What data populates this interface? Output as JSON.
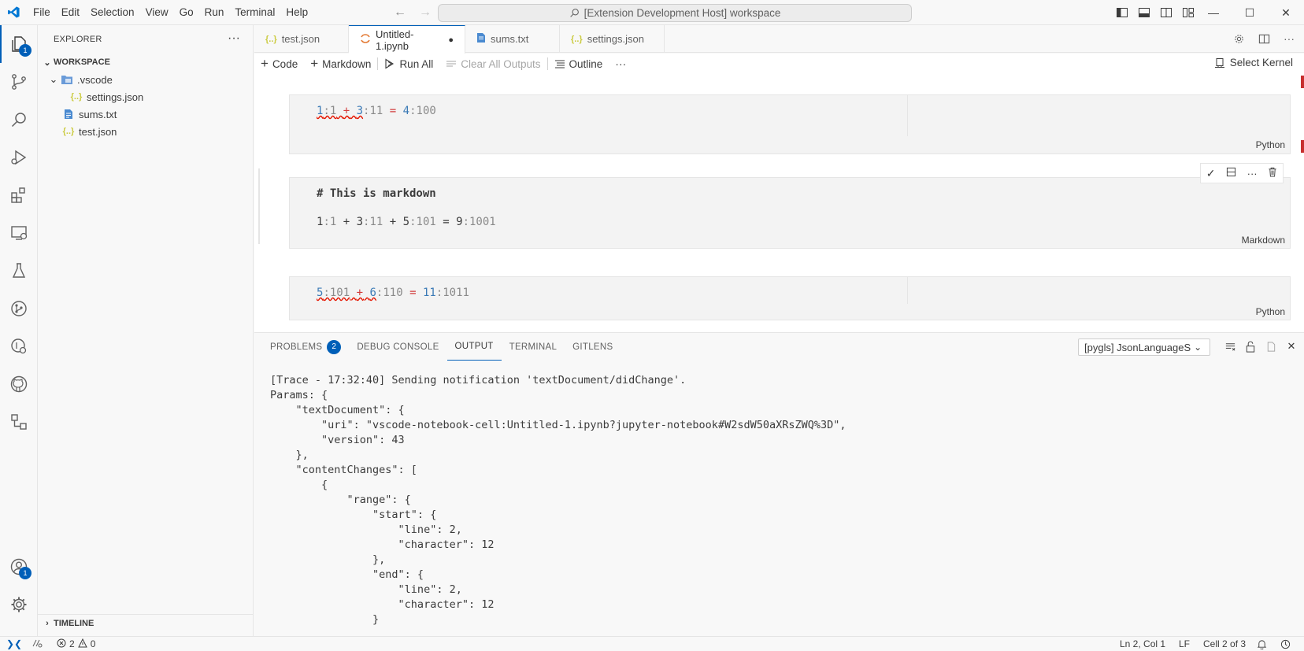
{
  "titlebar": {
    "menu": [
      "File",
      "Edit",
      "Selection",
      "View",
      "Go",
      "Run",
      "Terminal",
      "Help"
    ],
    "command_center": "[Extension Development Host] workspace"
  },
  "activitybar": {
    "explorer_badge": "1",
    "accounts_badge": "1"
  },
  "sidebar": {
    "title": "EXPLORER",
    "workspace_label": "WORKSPACE",
    "tree": [
      {
        "label": ".vscode",
        "type": "folder"
      },
      {
        "label": "settings.json",
        "type": "json"
      },
      {
        "label": "sums.txt",
        "type": "txt"
      },
      {
        "label": "test.json",
        "type": "json"
      }
    ],
    "timeline_label": "TIMELINE"
  },
  "tabs": [
    {
      "label": "test.json",
      "active": false
    },
    {
      "label": "Untitled-1.ipynb",
      "active": true,
      "dirty": true
    },
    {
      "label": "sums.txt",
      "active": false
    },
    {
      "label": "settings.json",
      "active": false
    }
  ],
  "notebook_toolbar": {
    "code": "Code",
    "markdown": "Markdown",
    "run_all": "Run All",
    "clear_all": "Clear All Outputs",
    "outline": "Outline",
    "select_kernel": "Select Kernel"
  },
  "cells": {
    "cell1": {
      "a": "1",
      "a_bits": ":1",
      "plus": "+",
      "b": "3",
      "b_bits": ":11",
      "eq": "=",
      "c": "4",
      "c_bits": ":100",
      "lang": "Python"
    },
    "cell2": {
      "heading": "# This is markdown",
      "line": [
        "1",
        ":1",
        "+",
        "3",
        ":11",
        "+",
        "5",
        ":101",
        "=",
        "9",
        ":1001"
      ],
      "lang": "Markdown"
    },
    "cell3": {
      "a": "5",
      "a_bits": ":101",
      "plus": "+",
      "b": "6",
      "b_bits": ":110",
      "eq": "=",
      "c": "11",
      "c_bits": ":1011",
      "lang": "Python"
    }
  },
  "panel": {
    "tabs": {
      "problems": "PROBLEMS",
      "problems_count": "2",
      "debug_console": "DEBUG CONSOLE",
      "output": "OUTPUT",
      "terminal": "TERMINAL",
      "gitlens": "GITLENS"
    },
    "channel": "[pygls] JsonLanguageS",
    "output_lines": [
      "[Trace - 17:32:40] Sending notification 'textDocument/didChange'.",
      "Params: {",
      "    \"textDocument\": {",
      "        \"uri\": \"vscode-notebook-cell:Untitled-1.ipynb?jupyter-notebook#W2sdW50aXRsZWQ%3D\",",
      "        \"version\": 43",
      "    },",
      "    \"contentChanges\": [",
      "        {",
      "            \"range\": {",
      "                \"start\": {",
      "                    \"line\": 2,",
      "                    \"character\": 12",
      "                },",
      "                \"end\": {",
      "                    \"line\": 2,",
      "                    \"character\": 12",
      "                }",
      "            },"
    ]
  },
  "statusbar": {
    "errors": "2",
    "warnings": "0",
    "position": "Ln 2, Col 1",
    "eol": "LF",
    "cell": "Cell 2 of 3"
  },
  "colors": {
    "accent": "#005fb8",
    "error_squiggle": "#e51400",
    "vscode_logo": "#0078d4"
  }
}
